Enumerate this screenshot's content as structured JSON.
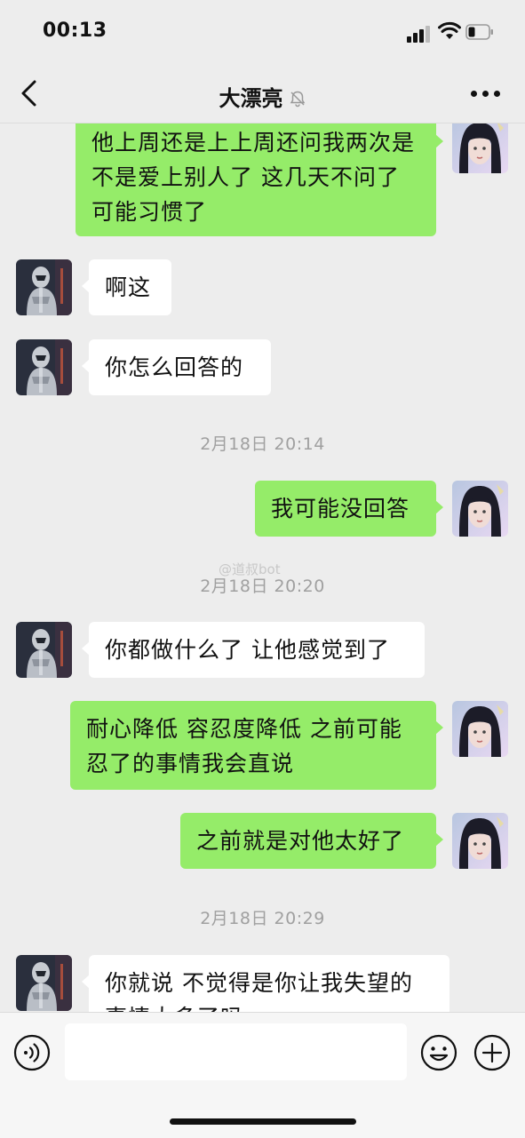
{
  "status_bar": {
    "time": "00:13"
  },
  "header": {
    "title": "大漂亮"
  },
  "messages": [
    {
      "id": "m1",
      "sender": "me",
      "text": "他上周还是上上周还问我两次是不是爱上别人了 这几天不问了 可能习惯了"
    },
    {
      "id": "m2",
      "sender": "them",
      "text": "啊这"
    },
    {
      "id": "m3",
      "sender": "them",
      "text": "你怎么回答的"
    },
    {
      "id": "t1",
      "type": "timestamp",
      "text": "2月18日 20:14"
    },
    {
      "id": "m4",
      "sender": "me",
      "text": "我可能没回答"
    },
    {
      "id": "t2",
      "type": "timestamp",
      "text": "2月18日 20:20"
    },
    {
      "id": "m5",
      "sender": "them",
      "text": "你都做什么了 让他感觉到了"
    },
    {
      "id": "m6",
      "sender": "me",
      "text": "耐心降低 容忍度降低 之前可能忍了的事情我会直说"
    },
    {
      "id": "m7",
      "sender": "me",
      "text": "之前就是对他太好了"
    },
    {
      "id": "t3",
      "type": "timestamp",
      "text": "2月18日 20:29"
    },
    {
      "id": "m8",
      "sender": "them",
      "text": "你就说 不觉得是你让我失望的事情太多了吗"
    }
  ],
  "watermark": "@道叔bot",
  "colors": {
    "my_bubble": "#95ec69",
    "their_bubble": "#ffffff",
    "background": "#ededed"
  },
  "icons": {
    "back": "chevron-left-icon",
    "mute": "bell-slash-icon",
    "more": "more-dots-icon",
    "voice": "voice-icon",
    "emoji": "emoji-icon",
    "add": "plus-circle-icon"
  }
}
